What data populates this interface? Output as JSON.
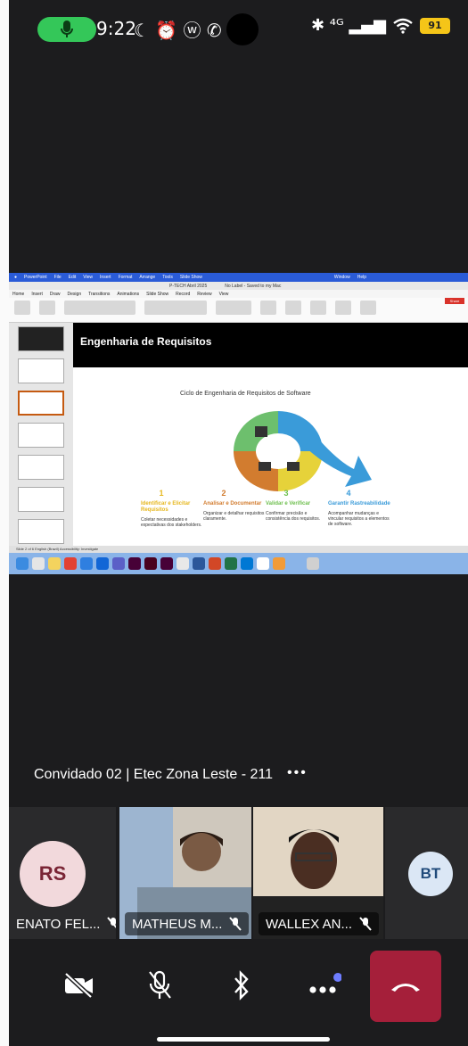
{
  "status_bar": {
    "time": "9:22",
    "glyphs": "☾ ⏰ ⓦ ✆",
    "right_glyphs": "✱ ⁴ᴳ ▂▄▆",
    "battery": "91"
  },
  "shared_screen": {
    "mac_menu": [
      "PowerPoint",
      "File",
      "Edit",
      "View",
      "Insert",
      "Format",
      "Arrange",
      "Tools",
      "Slide Show",
      "Window",
      "Help"
    ],
    "document_title": "P-TECH Abril 2025",
    "label_text": "No Label - Saved to my Mac",
    "tabs": [
      "Home",
      "Insert",
      "Draw",
      "Design",
      "Transitions",
      "Animations",
      "Slide Show",
      "Record",
      "Review",
      "View"
    ],
    "share_label": "Share",
    "slide_header": "Engenharia de Requisitos",
    "cycle_title": "Ciclo de Engenharia de Requisitos de Software",
    "steps": [
      {
        "num": "1",
        "title": "Identificar e Elicitar Requisitos",
        "text": "Coletar necessidades e expectativas dos stakeholders.",
        "color": "#a9c73a"
      },
      {
        "num": "2",
        "title": "Analisar e Documentar",
        "text": "Organizar e detalhar requisitos claramente.",
        "color": "#d27c2f"
      },
      {
        "num": "3",
        "title": "Validar e Verificar",
        "text": "Confirmar precisão e consistência dos requisitos.",
        "color": "#6dbf4d"
      },
      {
        "num": "4",
        "title": "Garantir Rastreabilidade",
        "text": "Acompanhar mudanças e vincular requisitos a elementos de software.",
        "color": "#3a9bd9"
      }
    ],
    "status_text": "Slide 2 of 6   English (Brazil)   Accessibility: Investigate"
  },
  "presenter_label": "Convidado 02 | Etec Zona Leste - 211",
  "more_glyph": "•••",
  "participants": [
    {
      "initials": "RS",
      "name": "ENATO FEL...",
      "avatar_bg": "#f2d9dc",
      "avatar_fg": "#7a2535"
    },
    {
      "name": "MATHEUS M..."
    },
    {
      "name": "WALLEX AN..."
    },
    {
      "initials": "BT",
      "avatar_bg": "#dbe7f5",
      "avatar_fg": "#1f4a7a"
    }
  ],
  "colors": {
    "end_call": "#a51f3a",
    "mic_active": "#34c759",
    "notification_dot": "#6e7dff"
  }
}
